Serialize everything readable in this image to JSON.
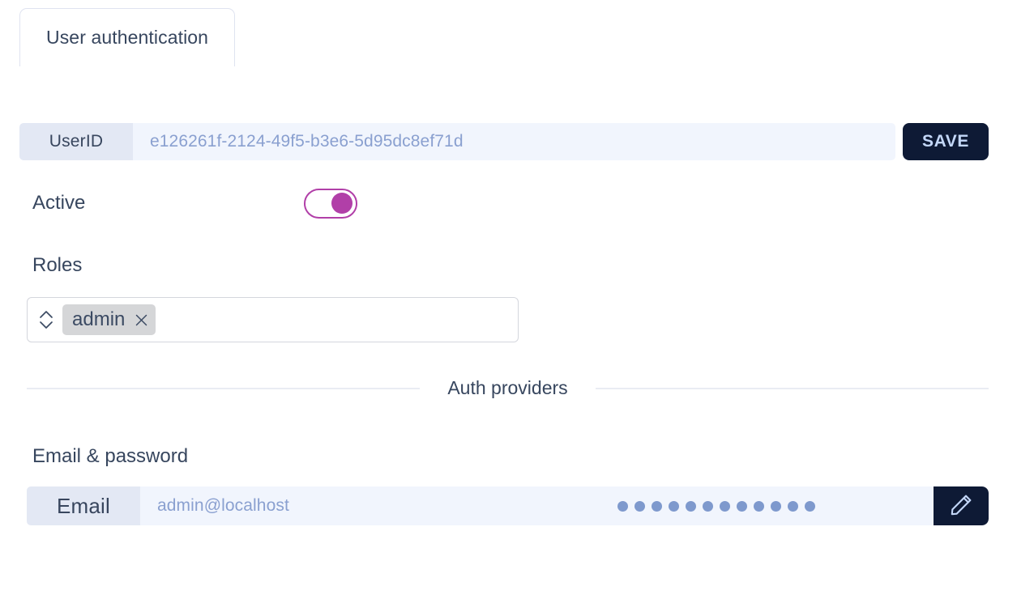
{
  "tabs": [
    {
      "label": "User authentication",
      "active": true
    }
  ],
  "userid": {
    "label": "UserID",
    "value": "e126261f-2124-49f5-b3e6-5d95dc8ef71d",
    "placeholder": "UserID"
  },
  "save": {
    "label": "SAVE"
  },
  "active": {
    "label": "Active",
    "on": true
  },
  "roles": {
    "label": "Roles",
    "chips": [
      {
        "label": "admin",
        "remove_icon": "close-icon"
      }
    ],
    "selector_icon": "up-down-chevron-icon"
  },
  "auth_providers": {
    "divider_caption": "Auth providers"
  },
  "email_password": {
    "label": "Email & password",
    "field_label": "Email",
    "email_value": "admin@localhost",
    "password_masked": "●●●●●●●●●●●●",
    "password_dot_count": 12,
    "edit_icon": "pencil-icon"
  },
  "colors": {
    "accent_dark": "#0e1a35",
    "accent_on_dark_text": "#c3d7f8",
    "toggle_on": "#b13fa8",
    "field_bg": "#f1f5fd",
    "field_label_bg": "#e3e8f4",
    "field_value_text": "#8aa0d0",
    "heading_text": "#37465e",
    "chip_bg": "#d5d6d8",
    "divider": "#e9ecf3",
    "tab_border": "#dfe3f0"
  }
}
